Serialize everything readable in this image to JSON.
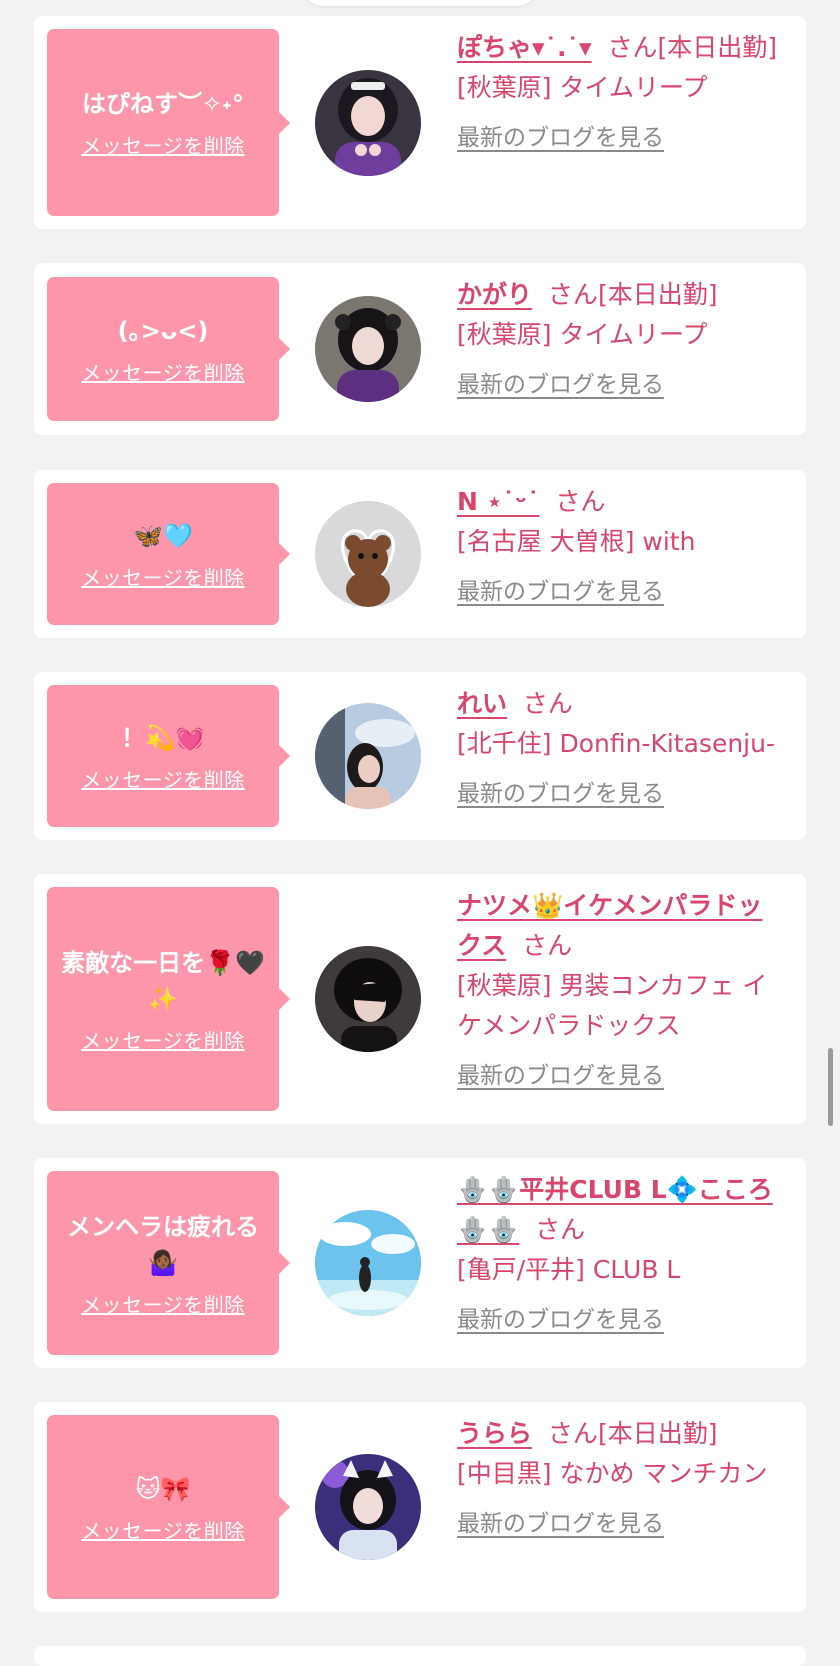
{
  "delete_label": "メッセージを削除",
  "blog_label": "最新のブログを見る",
  "san_label": "さん",
  "cards": [
    {
      "message": "はぴねす︶✧˖°",
      "name": "ぽちゃ▾˙.˙▾",
      "status": "[本日出勤]",
      "shop": "[秋葉原] タイムリープ"
    },
    {
      "message": "(｡>ᴗ<)",
      "name": "かがり",
      "status": "[本日出勤]",
      "shop": "[秋葉原] タイムリープ"
    },
    {
      "message": "🦋🩵",
      "name": "N ⋆˙ᵕ˙",
      "status": "",
      "shop": "[名古屋 大曽根] with"
    },
    {
      "message": "！💫💓",
      "name": "れい",
      "status": "",
      "shop": "[北千住] Donfin-Kitasenju-"
    },
    {
      "message": "素敵な一日を🌹🖤✨",
      "name": "ナツメ👑イケメンパラドックス",
      "status": "",
      "shop": "[秋葉原] 男装コンカフェ イケメンパラドックス"
    },
    {
      "message": "メンヘラは疲れる🤷🏾‍♀️",
      "name": "🪬🪬平井CLUB L💠こころ🪬🪬",
      "status": "",
      "shop": "[亀戸/平井] CLUB L"
    },
    {
      "message": "🐱🎀",
      "name": "うらら",
      "status": "[本日出勤]",
      "shop": "[中目黒] なかめ マンチカン"
    }
  ]
}
